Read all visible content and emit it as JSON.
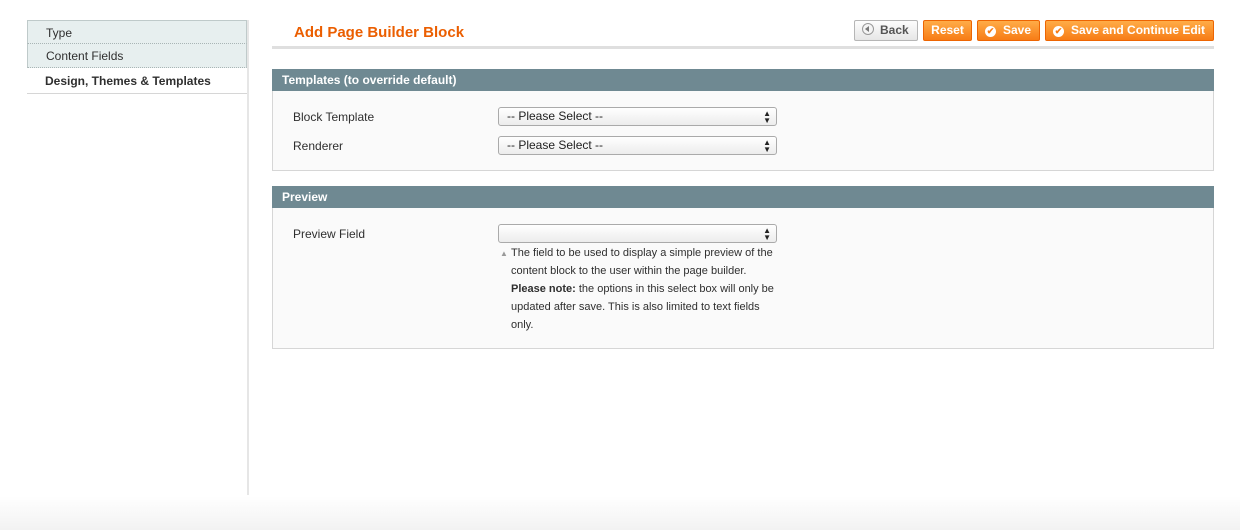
{
  "sidebar": {
    "tabs": [
      {
        "label": "Type"
      },
      {
        "label": "Content Fields"
      },
      {
        "label": "Design, Themes & Templates"
      }
    ]
  },
  "header": {
    "title": "Add Page Builder Block",
    "buttons": {
      "back": "Back",
      "reset": "Reset",
      "save": "Save",
      "save_continue": "Save and Continue Edit"
    }
  },
  "templates": {
    "legend": "Templates (to override default)",
    "block_template": {
      "label": "Block Template",
      "value": "-- Please Select --"
    },
    "renderer": {
      "label": "Renderer",
      "value": "-- Please Select --"
    }
  },
  "preview": {
    "legend": "Preview",
    "field": {
      "label": "Preview Field",
      "value": ""
    },
    "note_lines": {
      "l1": "The field to be used to display a simple preview of the",
      "l2": "content block to the user within the page builder.",
      "bold": "Please note:",
      "l3": " the options in this select box will only be",
      "l4": "updated after save. This is also limited to text fields",
      "l5": "only."
    }
  },
  "colors": {
    "accent": "#eb5e00",
    "button_orange": "#f77c16",
    "section_header": "#6f8992"
  }
}
